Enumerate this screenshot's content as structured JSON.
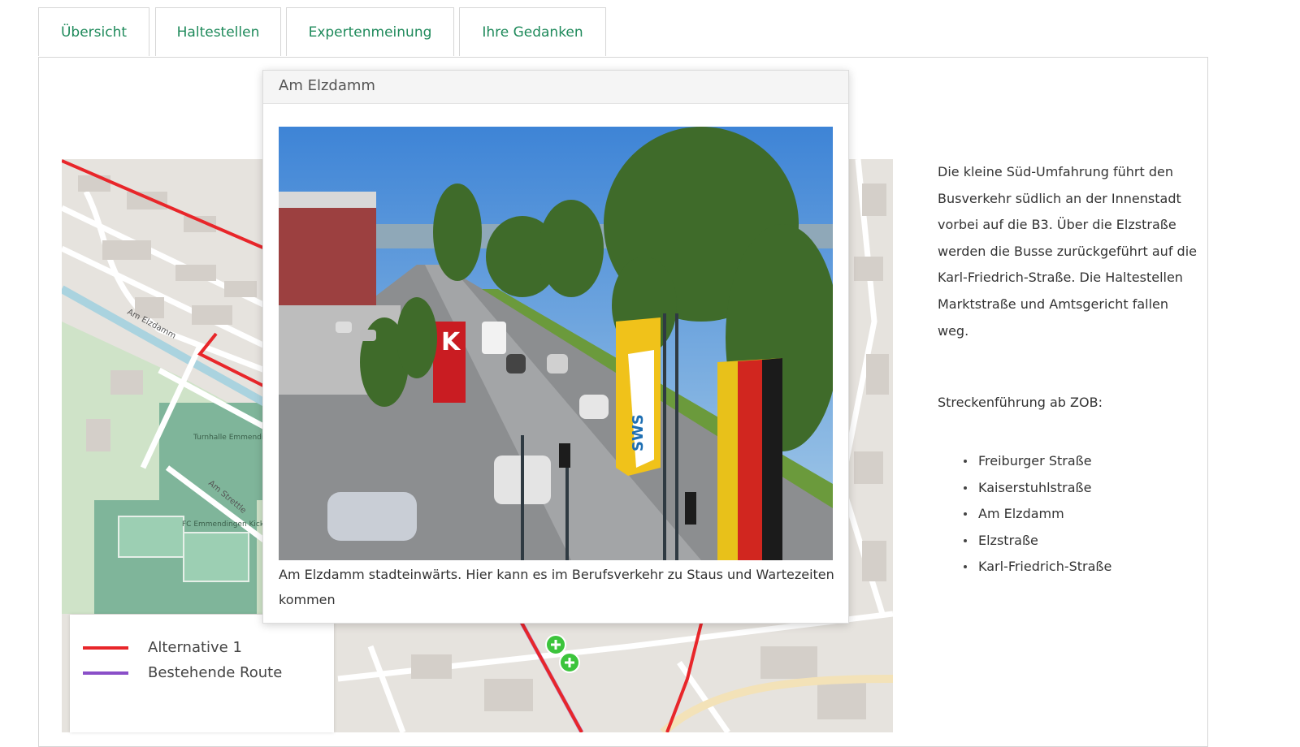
{
  "tabs": [
    {
      "label": "Übersicht"
    },
    {
      "label": "Haltestellen"
    },
    {
      "label": "Expertenmeinung"
    },
    {
      "label": "Ihre Gedanken"
    }
  ],
  "popup": {
    "title": "Am Elzdamm",
    "caption": "Am Elzdamm stadteinwärts. Hier kann es im Berufsverkehr zu Staus und Wartezeiten kommen",
    "photo_sign_text": "SWS",
    "photo_store_letter": "K"
  },
  "map": {
    "street_labels": [
      "Am Elzdamm",
      "Am Strettle"
    ],
    "place_labels": [
      "Turnhalle Emmendingen",
      "FC Emmendingen Kickplatz"
    ]
  },
  "legend": {
    "items": [
      {
        "label": "Alternative 1",
        "color": "#e8262a"
      },
      {
        "label": "Bestehende Route",
        "color": "#8a4fc8"
      }
    ]
  },
  "description": "Die kleine Süd-Umfahrung führt den Busverkehr südlich an der Innenstadt vorbei auf die B3. Über die Elzstraße werden die Busse zurückgeführt auf die Karl-Friedrich-Straße. Die Haltestellen Marktstraße und Amtsgericht fallen weg.",
  "route": {
    "heading": "Streckenführung ab ZOB:",
    "stops": [
      "Freiburger Straße",
      "Kaiserstuhlstraße",
      "Am Elzdamm",
      "Elzstraße",
      "Karl-Friedrich-Straße"
    ]
  },
  "colors": {
    "tab_text": "#1f8a5b",
    "route_red": "#e8262a",
    "stop_marker_green": "#3cc43c"
  }
}
